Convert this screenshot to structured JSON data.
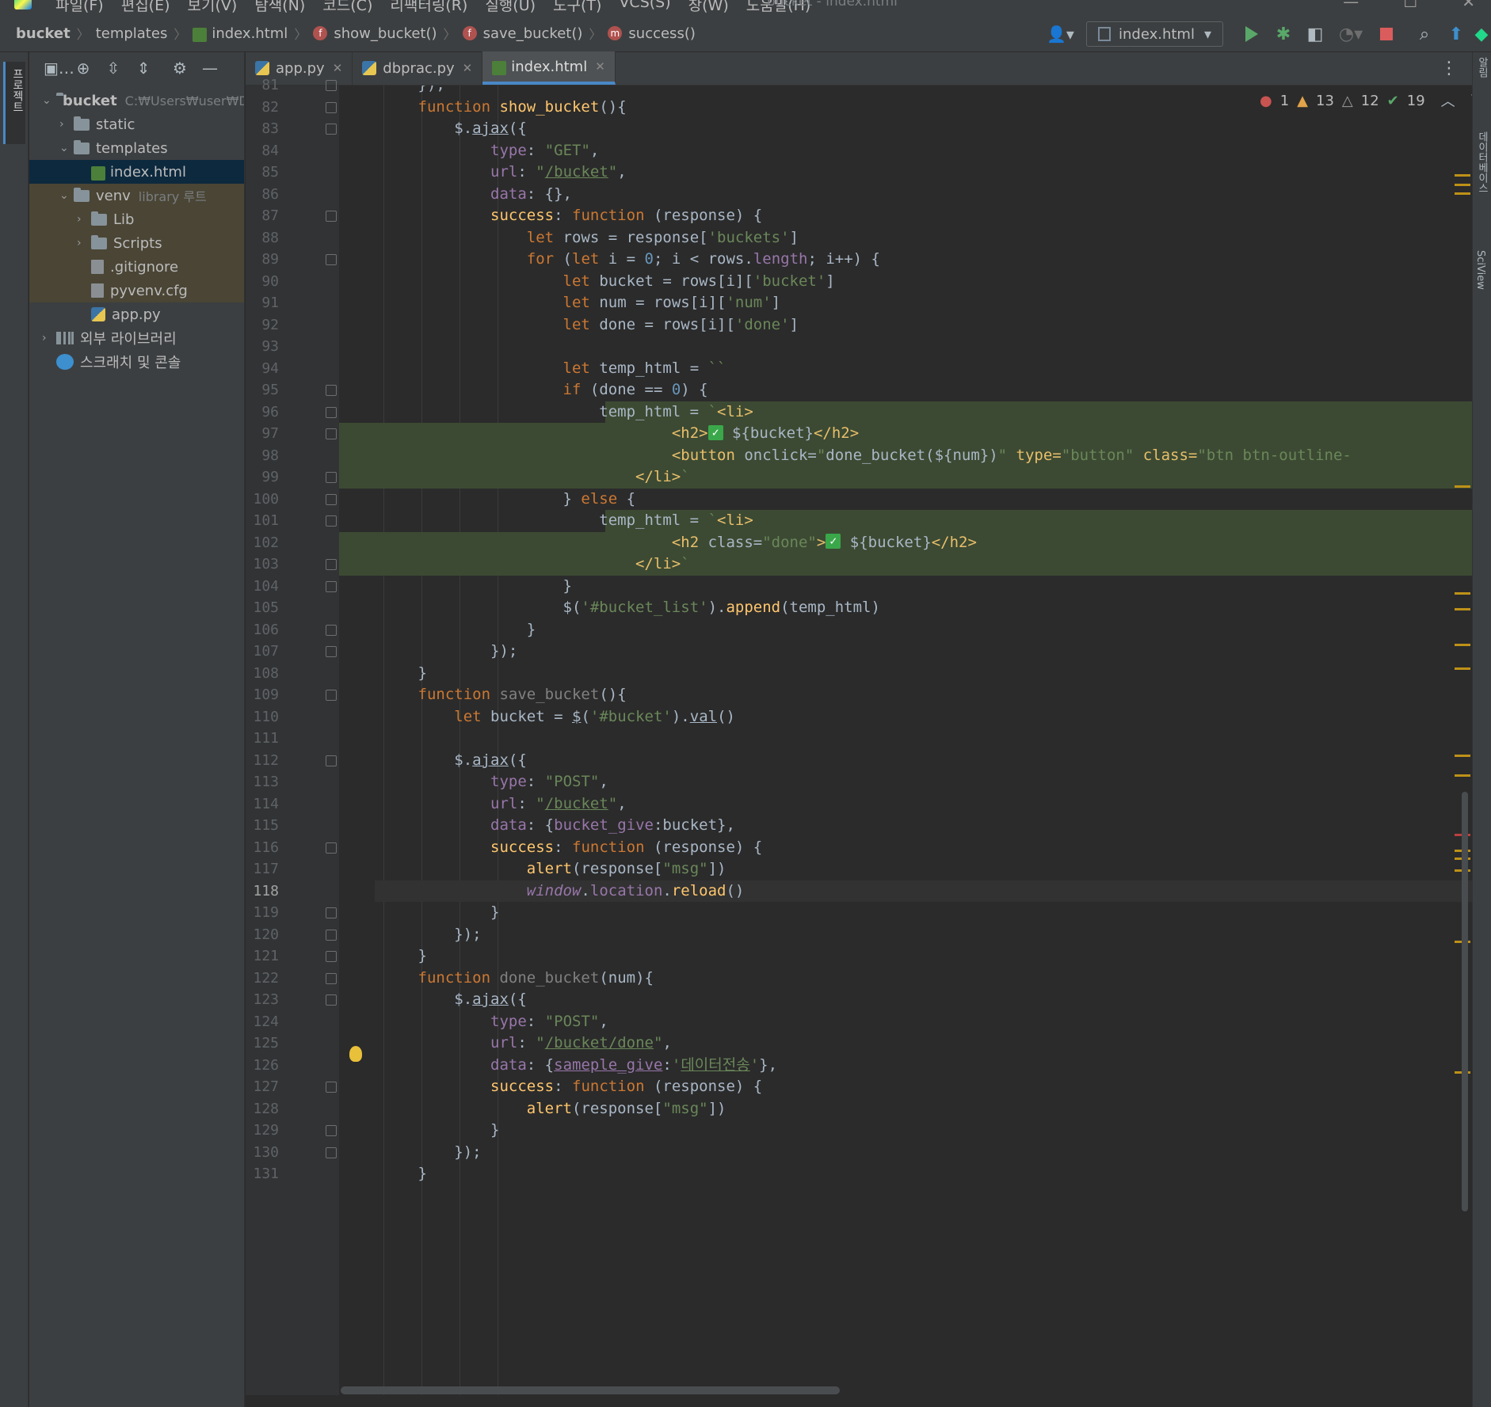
{
  "window": {
    "title": "bucket - index.html",
    "menu": [
      "파일(F)",
      "편집(E)",
      "보기(V)",
      "탐색(N)",
      "코드(C)",
      "리팩터링(R)",
      "실행(U)",
      "도구(T)",
      "VCS(S)",
      "창(W)",
      "도움말(H)"
    ]
  },
  "breadcrumb": [
    "bucket",
    "templates",
    "index.html",
    "show_bucket()",
    "save_bucket()",
    "success()"
  ],
  "run_config": "index.html",
  "left_strip": {
    "project_tab": "프로젝트"
  },
  "right_strip": {
    "tab1": "알림",
    "tab2": "데이터베이스",
    "tab3": "SciView"
  },
  "project_tree": [
    {
      "label": "bucket",
      "hint": "C:₩Users₩user₩De",
      "level": 0,
      "type": "folder",
      "expanded": true
    },
    {
      "label": "static",
      "level": 1,
      "type": "folder"
    },
    {
      "label": "templates",
      "level": 1,
      "type": "folder",
      "expanded": true
    },
    {
      "label": "index.html",
      "level": 2,
      "type": "html",
      "selected": true
    },
    {
      "label": "venv",
      "hint": "library 루트",
      "level": 1,
      "type": "folder",
      "expanded": true
    },
    {
      "label": "Lib",
      "level": 2,
      "type": "folder"
    },
    {
      "label": "Scripts",
      "level": 2,
      "type": "folder"
    },
    {
      "label": ".gitignore",
      "level": 2,
      "type": "file"
    },
    {
      "label": "pyvenv.cfg",
      "level": 2,
      "type": "file"
    },
    {
      "label": "app.py",
      "level": 1,
      "type": "py"
    },
    {
      "label": "외부 라이브러리",
      "level": 0,
      "type": "lib"
    },
    {
      "label": "스크래치 및 콘솔",
      "level": 0,
      "type": "scratch"
    }
  ],
  "tabs": [
    {
      "label": "app.py",
      "active": false
    },
    {
      "label": "dbprac.py",
      "active": false
    },
    {
      "label": "index.html",
      "active": true
    }
  ],
  "inspections": {
    "errors": "1",
    "warnings": "13",
    "weak_warnings": "12",
    "ok": "19"
  },
  "editor": {
    "current_line": 118,
    "lines": [
      {
        "n": "81",
        "html": "        });"
      },
      {
        "n": "82",
        "html": "        <span class='kw'>function</span> <span class='fn'>show_bucket</span>(){"
      },
      {
        "n": "83",
        "html": "            $.<span class='u'>ajax</span>({"
      },
      {
        "n": "84",
        "html": "                <span class='prop'>type</span>: <span class='st'>\"GET\"</span>,"
      },
      {
        "n": "85",
        "html": "                <span class='prop'>url</span>: <span class='st'>\"<span class='u'>/bucket</span>\"</span>,"
      },
      {
        "n": "86",
        "html": "                <span class='prop'>data</span>: {},"
      },
      {
        "n": "87",
        "html": "                <span class='fn'>success</span>: <span class='kw'>function</span> (response) {"
      },
      {
        "n": "88",
        "html": "                    <span class='kw'>let</span> rows = response[<span class='st'>'buckets'</span>]"
      },
      {
        "n": "89",
        "html": "                    <span class='kw'>for</span> (<span class='kw'>let</span> i = <span class='num'>0</span>; i &lt; rows.<span class='prop'>length</span>; i++) {"
      },
      {
        "n": "90",
        "html": "                        <span class='kw'>let</span> bucket = rows[i][<span class='st'>'bucket'</span>]"
      },
      {
        "n": "91",
        "html": "                        <span class='kw'>let</span> num = rows[i][<span class='st'>'num'</span>]"
      },
      {
        "n": "92",
        "html": "                        <span class='kw'>let</span> done = rows[i][<span class='st'>'done'</span>]"
      },
      {
        "n": "93",
        "html": ""
      },
      {
        "n": "94",
        "html": "                        <span class='kw'>let</span> temp_html = <span class='st'>``</span>"
      },
      {
        "n": "95",
        "html": "                        <span class='kw'>if</span> (done == <span class='num'>0</span>) {"
      },
      {
        "n": "96",
        "html": "                            temp_html = <span class='st'>`</span><span class='tag'>&lt;li&gt;</span>",
        "bg": "green-partial"
      },
      {
        "n": "97",
        "html": "                                    <span class='tag'>&lt;h2&gt;</span><span class='chk'>✓</span> ${bucket}<span class='tag'>&lt;/h2&gt;</span>",
        "bg": "green"
      },
      {
        "n": "98",
        "html": "                                    <span class='tag'>&lt;button </span>onclick=<span class='st'>\"</span>done_bucket(${num})<span class='st'>\"</span> <span class='tag'>type=</span><span class='st'>\"button\"</span> <span class='tag'>class=</span><span class='st'>\"btn btn-outline-</span>",
        "bg": "green"
      },
      {
        "n": "99",
        "html": "                                <span class='tag'>&lt;/li&gt;</span><span class='st'>`</span>",
        "bg": "green"
      },
      {
        "n": "100",
        "html": "                        } <span class='kw'>else</span> {"
      },
      {
        "n": "101",
        "html": "                            temp_html = <span class='st'>`</span><span class='tag'>&lt;li&gt;</span>",
        "bg": "green-partial"
      },
      {
        "n": "102",
        "html": "                                    <span class='tag'>&lt;h2 </span>class=<span class='st'>\"done\"</span><span class='tag'>&gt;</span><span class='chk'>✓</span> ${bucket}<span class='tag'>&lt;/h2&gt;</span>",
        "bg": "green"
      },
      {
        "n": "103",
        "html": "                                <span class='tag'>&lt;/li&gt;</span><span class='st'>`</span>",
        "bg": "green"
      },
      {
        "n": "104",
        "html": "                        }"
      },
      {
        "n": "105",
        "html": "                        $(<span class='st'>'#bucket_list'</span>).<span class='fn'>append</span>(temp_html)"
      },
      {
        "n": "106",
        "html": "                    }"
      },
      {
        "n": "107",
        "html": "                });"
      },
      {
        "n": "108",
        "html": "        }"
      },
      {
        "n": "109",
        "html": "        <span class='kw'>function</span> <span class='gray'>save_bucket</span>(){"
      },
      {
        "n": "110",
        "html": "            <span class='kw'>let</span> bucket = <span class='u'>$</span>(<span class='st'>'#bucket'</span>).<span class='u'>val</span>()"
      },
      {
        "n": "111",
        "html": ""
      },
      {
        "n": "112",
        "html": "            $.<span class='u'>ajax</span>({"
      },
      {
        "n": "113",
        "html": "                <span class='prop'>type</span>: <span class='st'>\"POST\"</span>,"
      },
      {
        "n": "114",
        "html": "                <span class='prop'>url</span>: <span class='st'>\"<span class='u'>/bucket</span>\"</span>,"
      },
      {
        "n": "115",
        "html": "                <span class='prop'>data</span>: {<span class='prop'>bucket_give</span>:bucket},"
      },
      {
        "n": "116",
        "html": "                <span class='fn'>success</span>: <span class='kw'>function</span> (response) {"
      },
      {
        "n": "117",
        "html": "                    <span class='fn'>alert</span>(response[<span class='st'>\"msg\"</span>])"
      },
      {
        "n": "118",
        "html": "                    <span class='ital'>window</span>.<span class='prop'>location</span>.<span class='fn'>reload</span>()",
        "bg": "current"
      },
      {
        "n": "119",
        "html": "                }"
      },
      {
        "n": "120",
        "html": "            });"
      },
      {
        "n": "121",
        "html": "        }"
      },
      {
        "n": "122",
        "html": "        <span class='kw'>function</span> <span class='gray'>done_bucket</span>(num){"
      },
      {
        "n": "123",
        "html": "            $.<span class='u'>ajax</span>({"
      },
      {
        "n": "124",
        "html": "                <span class='prop'>type</span>: <span class='st'>\"POST\"</span>,"
      },
      {
        "n": "125",
        "html": "                <span class='prop'>url</span>: <span class='st'>\"<span class='u'>/bucket/done</span>\"</span>,"
      },
      {
        "n": "126",
        "html": "                <span class='prop'>data</span>: {<span class='prop u'>sameple_give</span>:<span class='st'>'<span class='u'>데이터전송</span>'</span>},"
      },
      {
        "n": "127",
        "html": "                <span class='fn'>success</span>: <span class='kw'>function</span> (response) {"
      },
      {
        "n": "128",
        "html": "                    <span class='fn'>alert</span>(response[<span class='st'>\"msg\"</span>])"
      },
      {
        "n": "129",
        "html": "                }"
      },
      {
        "n": "130",
        "html": "            });"
      },
      {
        "n": "131",
        "html": "        }"
      }
    ]
  }
}
